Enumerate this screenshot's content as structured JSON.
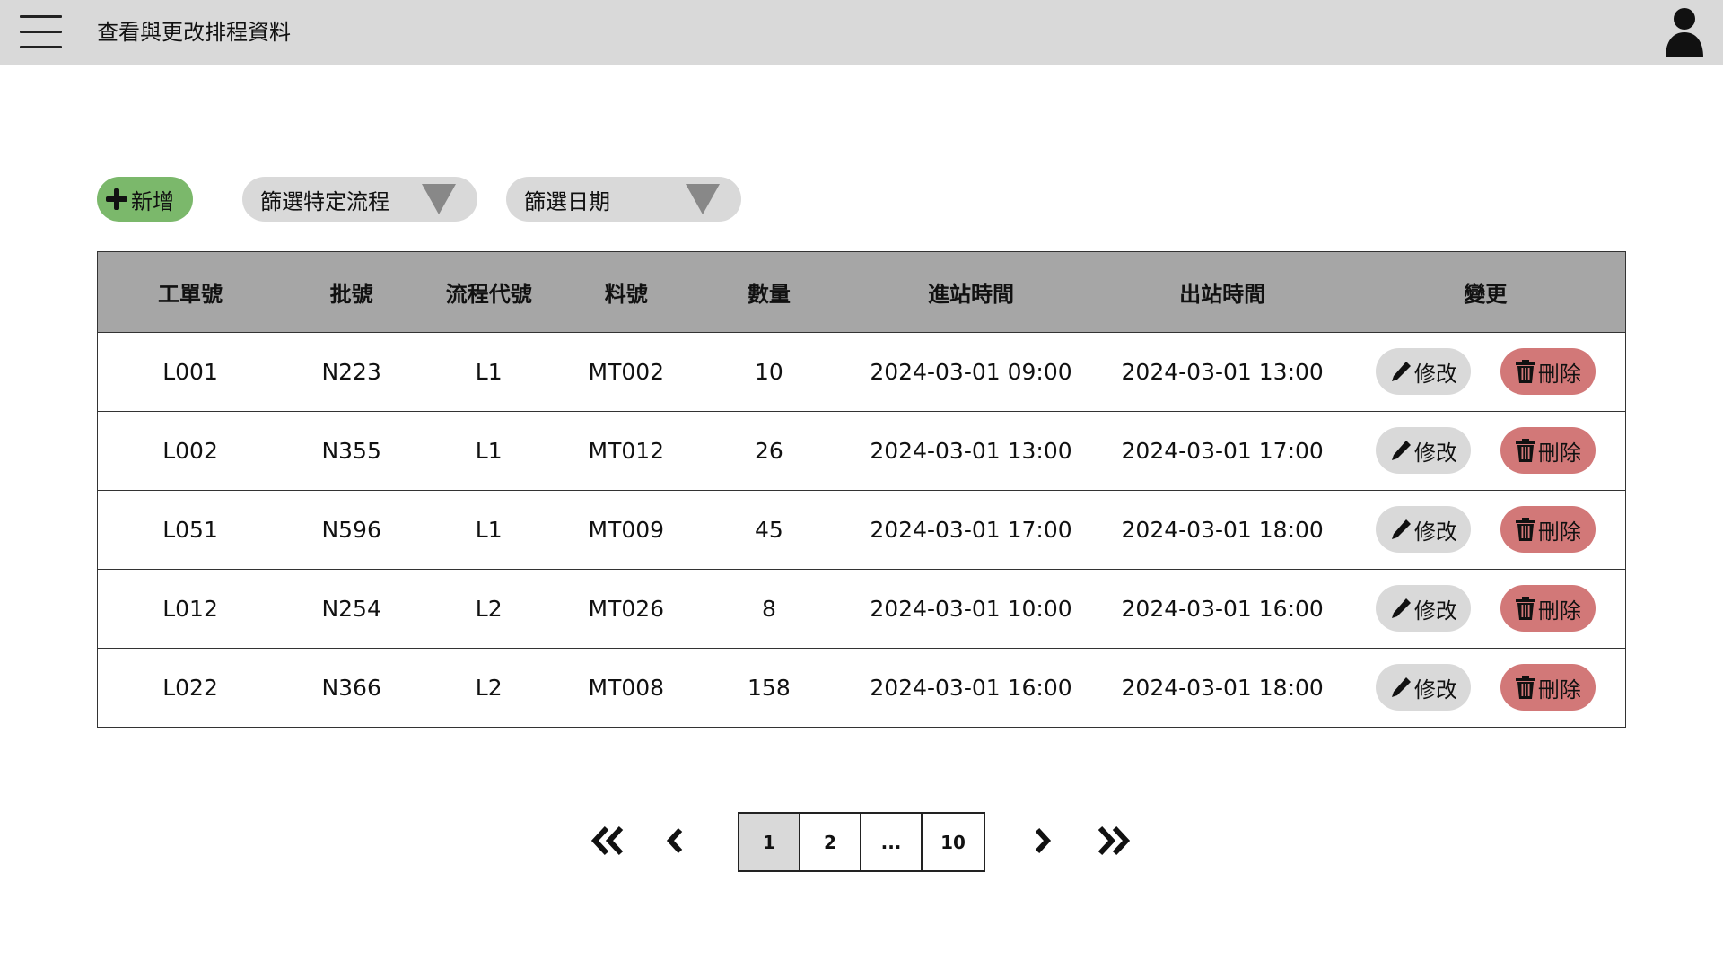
{
  "header": {
    "title": "查看與更改排程資料",
    "menu_icon": "hamburger-menu-icon",
    "user_icon": "user-avatar-icon"
  },
  "toolbar": {
    "add_label": "新增",
    "filter_flow_label": "篩選特定流程",
    "filter_date_label": "篩選日期"
  },
  "table": {
    "columns": [
      "工單號",
      "批號",
      "流程代號",
      "料號",
      "數量",
      "進站時間",
      "出站時間",
      "變更"
    ],
    "rows": [
      [
        "L001",
        "N223",
        "L1",
        "MT002",
        "10",
        "2024-03-01 09:00",
        "2024-03-01 13:00"
      ],
      [
        "L002",
        "N355",
        "L1",
        "MT012",
        "26",
        "2024-03-01 13:00",
        "2024-03-01 17:00"
      ],
      [
        "L051",
        "N596",
        "L1",
        "MT009",
        "45",
        "2024-03-01 17:00",
        "2024-03-01 18:00"
      ],
      [
        "L012",
        "N254",
        "L2",
        "MT026",
        "8",
        "2024-03-01 10:00",
        "2024-03-01 16:00"
      ],
      [
        "L022",
        "N366",
        "L2",
        "MT008",
        "158",
        "2024-03-01 16:00",
        "2024-03-01 18:00"
      ]
    ],
    "edit_label": "修改",
    "delete_label": "刪除"
  },
  "pagination": {
    "pages": [
      "1",
      "2",
      "...",
      "10"
    ],
    "current": "1"
  },
  "colors": {
    "topbar": "#d9d9d9",
    "add_button": "#7bb86b",
    "delete_button": "#d27878",
    "table_header": "#a6a6a6"
  }
}
